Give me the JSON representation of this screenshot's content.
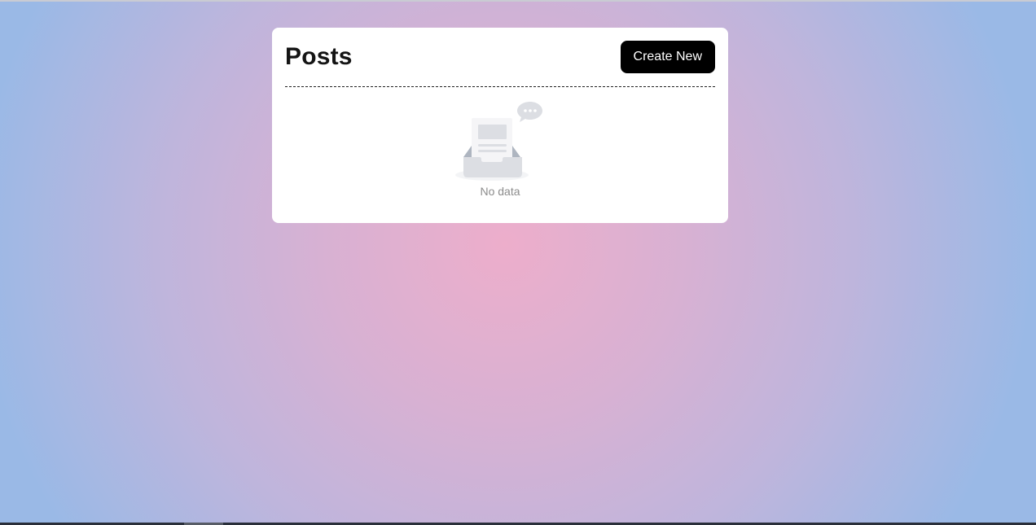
{
  "page": {
    "title": "Posts"
  },
  "header": {
    "create_label": "Create New"
  },
  "empty": {
    "text": "No data",
    "icon": "empty-inbox-icon"
  },
  "colors": {
    "button_bg": "#000000",
    "button_text": "#ffffff",
    "card_bg": "#ffffff",
    "empty_text": "#8c8c8c",
    "bg_center": "#edaecb",
    "bg_edge": "#9ab9e6"
  }
}
